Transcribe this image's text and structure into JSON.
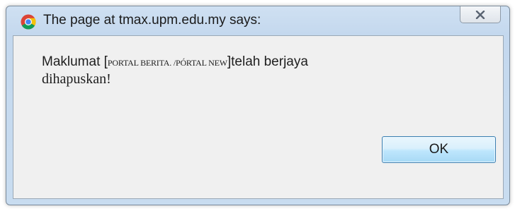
{
  "dialog": {
    "title": "The page at tmax.upm.edu.my says:",
    "close_icon": "close-x-icon",
    "app_icon": "chrome-icon"
  },
  "message": {
    "prefix": "Maklumat [",
    "bracket_text": "PORTAL BERITA. /PÓRTAL NEW",
    "suffix": "]telah berjaya",
    "line2": "dihapuskan!"
  },
  "buttons": {
    "ok_label": "OK"
  }
}
